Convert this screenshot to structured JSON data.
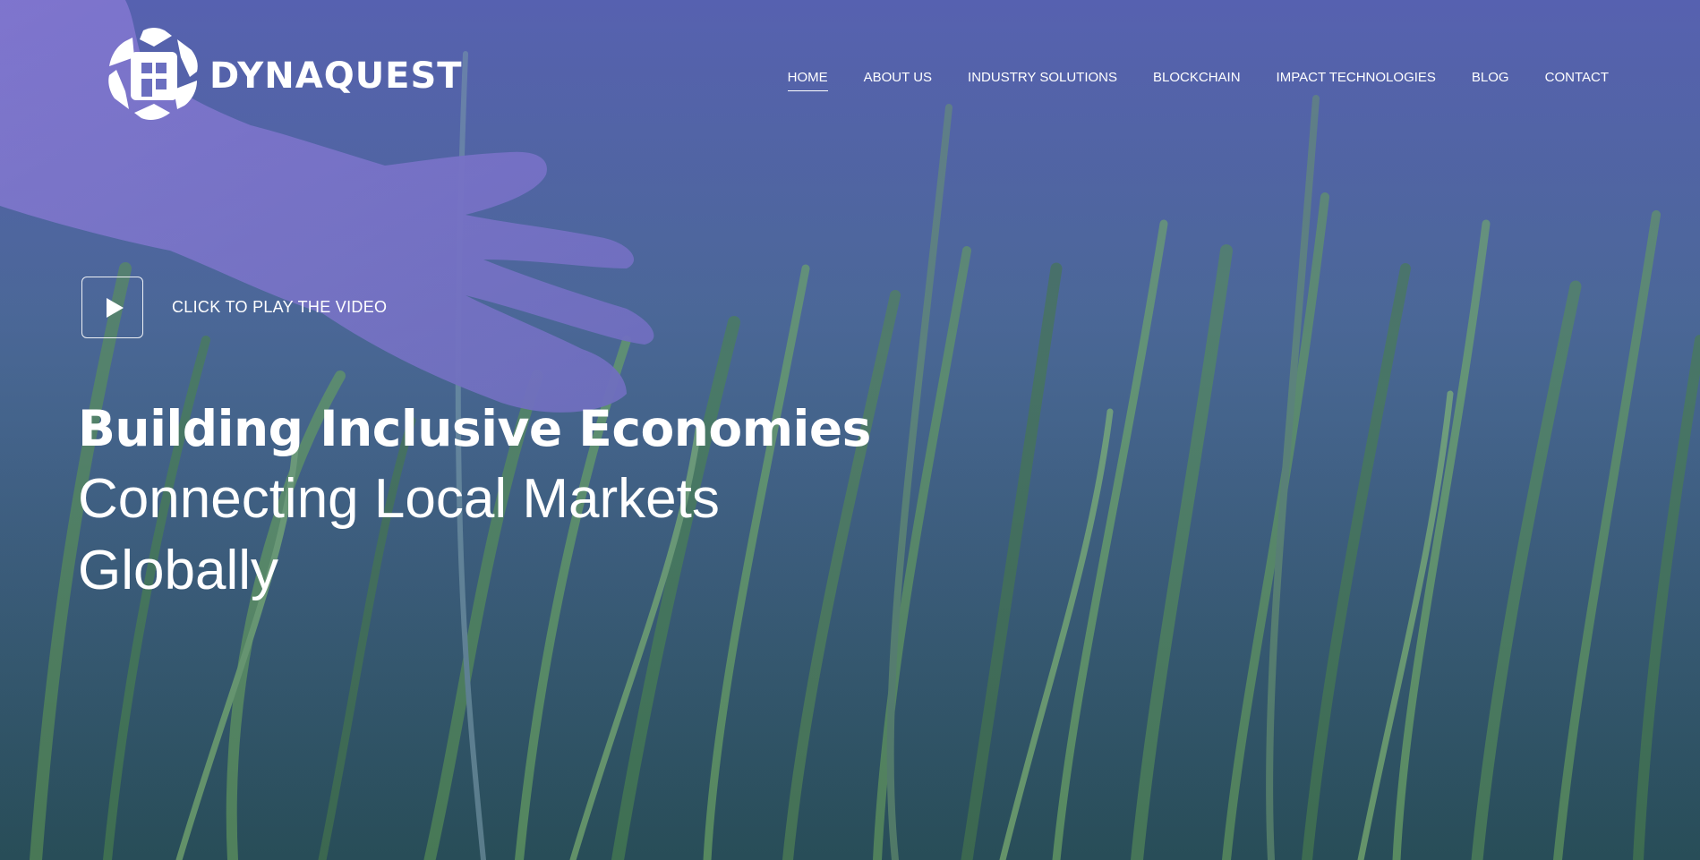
{
  "brand": {
    "name": "DYNAQUEST",
    "logo_icon": "dynaquest-logo-icon"
  },
  "nav": {
    "items": [
      {
        "label": "HOME",
        "active": true
      },
      {
        "label": "ABOUT US",
        "active": false
      },
      {
        "label": "INDUSTRY SOLUTIONS",
        "active": false
      },
      {
        "label": "BLOCKCHAIN",
        "active": false
      },
      {
        "label": "IMPACT TECHNOLOGIES",
        "active": false
      },
      {
        "label": "BLOG",
        "active": false
      },
      {
        "label": "CONTACT",
        "active": false
      }
    ]
  },
  "video": {
    "play_icon": "play-icon",
    "label": "CLICK TO PLAY THE VIDEO"
  },
  "hero": {
    "headline_bold": "Building Inclusive Economies",
    "headline_line2": "Connecting Local Markets",
    "headline_line3": "Globally"
  },
  "colors": {
    "text": "#ffffff",
    "overlay_tint": "#4a50b8",
    "grass_green": "#3f7a3a"
  }
}
